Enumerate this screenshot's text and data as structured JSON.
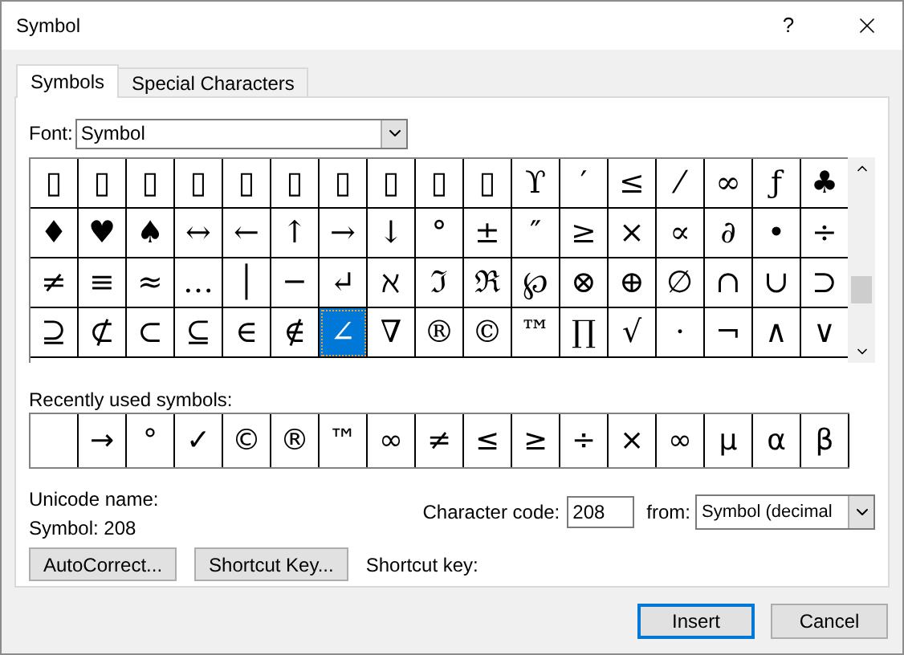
{
  "window": {
    "title": "Symbol",
    "help": "?"
  },
  "tabs": [
    {
      "label": "Symbols",
      "selected": true
    },
    {
      "label": "Special Characters",
      "selected": false
    }
  ],
  "font_field": {
    "label": "Font:",
    "value": "Symbol"
  },
  "symbol_grid": {
    "rows": [
      [
        {
          "symbol": "▯",
          "selected": false
        },
        {
          "symbol": "▯",
          "selected": false
        },
        {
          "symbol": "▯",
          "selected": false
        },
        {
          "symbol": "▯",
          "selected": false
        },
        {
          "symbol": "▯",
          "selected": false
        },
        {
          "symbol": "▯",
          "selected": false
        },
        {
          "symbol": "▯",
          "selected": false
        },
        {
          "symbol": "▯",
          "selected": false
        },
        {
          "symbol": "▯",
          "selected": false
        },
        {
          "symbol": "▯",
          "selected": false
        },
        {
          "symbol": "ϒ",
          "selected": false
        },
        {
          "symbol": "′",
          "selected": false
        },
        {
          "symbol": "≤",
          "selected": false
        },
        {
          "symbol": "⁄",
          "selected": false
        },
        {
          "symbol": "∞",
          "selected": false
        },
        {
          "symbol": "ƒ",
          "selected": false
        },
        {
          "symbol": "♣",
          "selected": false
        }
      ],
      [
        {
          "symbol": "♦",
          "selected": false
        },
        {
          "symbol": "♥",
          "selected": false
        },
        {
          "symbol": "♠",
          "selected": false
        },
        {
          "symbol": "↔",
          "selected": false
        },
        {
          "symbol": "←",
          "selected": false
        },
        {
          "symbol": "↑",
          "selected": false
        },
        {
          "symbol": "→",
          "selected": false
        },
        {
          "symbol": "↓",
          "selected": false
        },
        {
          "symbol": "°",
          "selected": false
        },
        {
          "symbol": "±",
          "selected": false
        },
        {
          "symbol": "″",
          "selected": false
        },
        {
          "symbol": "≥",
          "selected": false
        },
        {
          "symbol": "×",
          "selected": false
        },
        {
          "symbol": "∝",
          "selected": false
        },
        {
          "symbol": "∂",
          "selected": false
        },
        {
          "symbol": "•",
          "selected": false
        },
        {
          "symbol": "÷",
          "selected": false
        }
      ],
      [
        {
          "symbol": "≠",
          "selected": false
        },
        {
          "symbol": "≡",
          "selected": false
        },
        {
          "symbol": "≈",
          "selected": false
        },
        {
          "symbol": "…",
          "selected": false
        },
        {
          "symbol": "│",
          "selected": false
        },
        {
          "symbol": "─",
          "selected": false
        },
        {
          "symbol": "↵",
          "selected": false
        },
        {
          "symbol": "ℵ",
          "selected": false
        },
        {
          "symbol": "ℑ",
          "selected": false
        },
        {
          "symbol": "ℜ",
          "selected": false
        },
        {
          "symbol": "℘",
          "selected": false
        },
        {
          "symbol": "⊗",
          "selected": false
        },
        {
          "symbol": "⊕",
          "selected": false
        },
        {
          "symbol": "∅",
          "selected": false
        },
        {
          "symbol": "∩",
          "selected": false
        },
        {
          "symbol": "∪",
          "selected": false
        },
        {
          "symbol": "⊃",
          "selected": false
        }
      ],
      [
        {
          "symbol": "⊇",
          "selected": false
        },
        {
          "symbol": "⊄",
          "selected": false
        },
        {
          "symbol": "⊂",
          "selected": false
        },
        {
          "symbol": "⊆",
          "selected": false
        },
        {
          "symbol": "∈",
          "selected": false
        },
        {
          "symbol": "∉",
          "selected": false
        },
        {
          "symbol": "∠",
          "selected": true
        },
        {
          "symbol": "∇",
          "selected": false
        },
        {
          "symbol": "®",
          "selected": false
        },
        {
          "symbol": "©",
          "selected": false
        },
        {
          "symbol": "™",
          "selected": false
        },
        {
          "symbol": "∏",
          "selected": false
        },
        {
          "symbol": "√",
          "selected": false
        },
        {
          "symbol": "⋅",
          "selected": false
        },
        {
          "symbol": "¬",
          "selected": false
        },
        {
          "symbol": "∧",
          "selected": false
        },
        {
          "symbol": "∨",
          "selected": false
        }
      ]
    ]
  },
  "recently_used": {
    "label": "Recently used symbols:",
    "symbols": [
      "→",
      "°",
      "✓",
      "©",
      "®",
      "™",
      "∞",
      "≠",
      "≤",
      "≥",
      "÷",
      "×",
      "∞",
      "µ",
      "α",
      "β"
    ]
  },
  "unicode_name": {
    "label": "Unicode name:",
    "value": "Symbol: 208"
  },
  "character_code": {
    "label": "Character code:",
    "value": "208"
  },
  "from_field": {
    "label": "from:",
    "value": "Symbol (decimal"
  },
  "buttons": [
    "AutoCorrect...",
    "Shortcut Key..."
  ],
  "shortcut_key": {
    "label": "Shortcut key:"
  },
  "footer_buttons": [
    {
      "label": "Insert",
      "default": true
    },
    {
      "label": "Cancel",
      "default": false
    }
  ]
}
